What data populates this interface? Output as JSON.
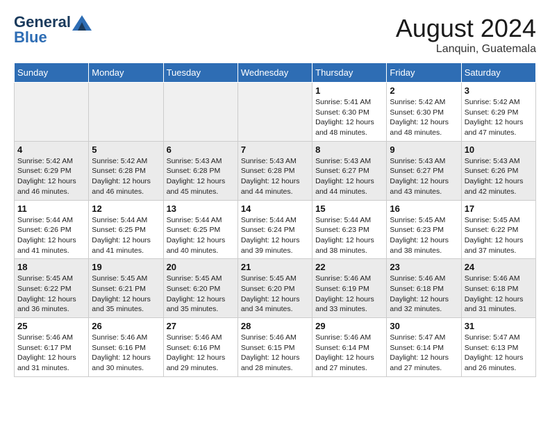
{
  "header": {
    "logo_line1": "General",
    "logo_line2": "Blue",
    "month_year": "August 2024",
    "location": "Lanquin, Guatemala"
  },
  "days_of_week": [
    "Sunday",
    "Monday",
    "Tuesday",
    "Wednesday",
    "Thursday",
    "Friday",
    "Saturday"
  ],
  "weeks": [
    [
      {
        "day": "",
        "info": ""
      },
      {
        "day": "",
        "info": ""
      },
      {
        "day": "",
        "info": ""
      },
      {
        "day": "",
        "info": ""
      },
      {
        "day": "1",
        "info": "Sunrise: 5:41 AM\nSunset: 6:30 PM\nDaylight: 12 hours\nand 48 minutes."
      },
      {
        "day": "2",
        "info": "Sunrise: 5:42 AM\nSunset: 6:30 PM\nDaylight: 12 hours\nand 48 minutes."
      },
      {
        "day": "3",
        "info": "Sunrise: 5:42 AM\nSunset: 6:29 PM\nDaylight: 12 hours\nand 47 minutes."
      }
    ],
    [
      {
        "day": "4",
        "info": "Sunrise: 5:42 AM\nSunset: 6:29 PM\nDaylight: 12 hours\nand 46 minutes."
      },
      {
        "day": "5",
        "info": "Sunrise: 5:42 AM\nSunset: 6:28 PM\nDaylight: 12 hours\nand 46 minutes."
      },
      {
        "day": "6",
        "info": "Sunrise: 5:43 AM\nSunset: 6:28 PM\nDaylight: 12 hours\nand 45 minutes."
      },
      {
        "day": "7",
        "info": "Sunrise: 5:43 AM\nSunset: 6:28 PM\nDaylight: 12 hours\nand 44 minutes."
      },
      {
        "day": "8",
        "info": "Sunrise: 5:43 AM\nSunset: 6:27 PM\nDaylight: 12 hours\nand 44 minutes."
      },
      {
        "day": "9",
        "info": "Sunrise: 5:43 AM\nSunset: 6:27 PM\nDaylight: 12 hours\nand 43 minutes."
      },
      {
        "day": "10",
        "info": "Sunrise: 5:43 AM\nSunset: 6:26 PM\nDaylight: 12 hours\nand 42 minutes."
      }
    ],
    [
      {
        "day": "11",
        "info": "Sunrise: 5:44 AM\nSunset: 6:26 PM\nDaylight: 12 hours\nand 41 minutes."
      },
      {
        "day": "12",
        "info": "Sunrise: 5:44 AM\nSunset: 6:25 PM\nDaylight: 12 hours\nand 41 minutes."
      },
      {
        "day": "13",
        "info": "Sunrise: 5:44 AM\nSunset: 6:25 PM\nDaylight: 12 hours\nand 40 minutes."
      },
      {
        "day": "14",
        "info": "Sunrise: 5:44 AM\nSunset: 6:24 PM\nDaylight: 12 hours\nand 39 minutes."
      },
      {
        "day": "15",
        "info": "Sunrise: 5:44 AM\nSunset: 6:23 PM\nDaylight: 12 hours\nand 38 minutes."
      },
      {
        "day": "16",
        "info": "Sunrise: 5:45 AM\nSunset: 6:23 PM\nDaylight: 12 hours\nand 38 minutes."
      },
      {
        "day": "17",
        "info": "Sunrise: 5:45 AM\nSunset: 6:22 PM\nDaylight: 12 hours\nand 37 minutes."
      }
    ],
    [
      {
        "day": "18",
        "info": "Sunrise: 5:45 AM\nSunset: 6:22 PM\nDaylight: 12 hours\nand 36 minutes."
      },
      {
        "day": "19",
        "info": "Sunrise: 5:45 AM\nSunset: 6:21 PM\nDaylight: 12 hours\nand 35 minutes."
      },
      {
        "day": "20",
        "info": "Sunrise: 5:45 AM\nSunset: 6:20 PM\nDaylight: 12 hours\nand 35 minutes."
      },
      {
        "day": "21",
        "info": "Sunrise: 5:45 AM\nSunset: 6:20 PM\nDaylight: 12 hours\nand 34 minutes."
      },
      {
        "day": "22",
        "info": "Sunrise: 5:46 AM\nSunset: 6:19 PM\nDaylight: 12 hours\nand 33 minutes."
      },
      {
        "day": "23",
        "info": "Sunrise: 5:46 AM\nSunset: 6:18 PM\nDaylight: 12 hours\nand 32 minutes."
      },
      {
        "day": "24",
        "info": "Sunrise: 5:46 AM\nSunset: 6:18 PM\nDaylight: 12 hours\nand 31 minutes."
      }
    ],
    [
      {
        "day": "25",
        "info": "Sunrise: 5:46 AM\nSunset: 6:17 PM\nDaylight: 12 hours\nand 31 minutes."
      },
      {
        "day": "26",
        "info": "Sunrise: 5:46 AM\nSunset: 6:16 PM\nDaylight: 12 hours\nand 30 minutes."
      },
      {
        "day": "27",
        "info": "Sunrise: 5:46 AM\nSunset: 6:16 PM\nDaylight: 12 hours\nand 29 minutes."
      },
      {
        "day": "28",
        "info": "Sunrise: 5:46 AM\nSunset: 6:15 PM\nDaylight: 12 hours\nand 28 minutes."
      },
      {
        "day": "29",
        "info": "Sunrise: 5:46 AM\nSunset: 6:14 PM\nDaylight: 12 hours\nand 27 minutes."
      },
      {
        "day": "30",
        "info": "Sunrise: 5:47 AM\nSunset: 6:14 PM\nDaylight: 12 hours\nand 27 minutes."
      },
      {
        "day": "31",
        "info": "Sunrise: 5:47 AM\nSunset: 6:13 PM\nDaylight: 12 hours\nand 26 minutes."
      }
    ]
  ]
}
